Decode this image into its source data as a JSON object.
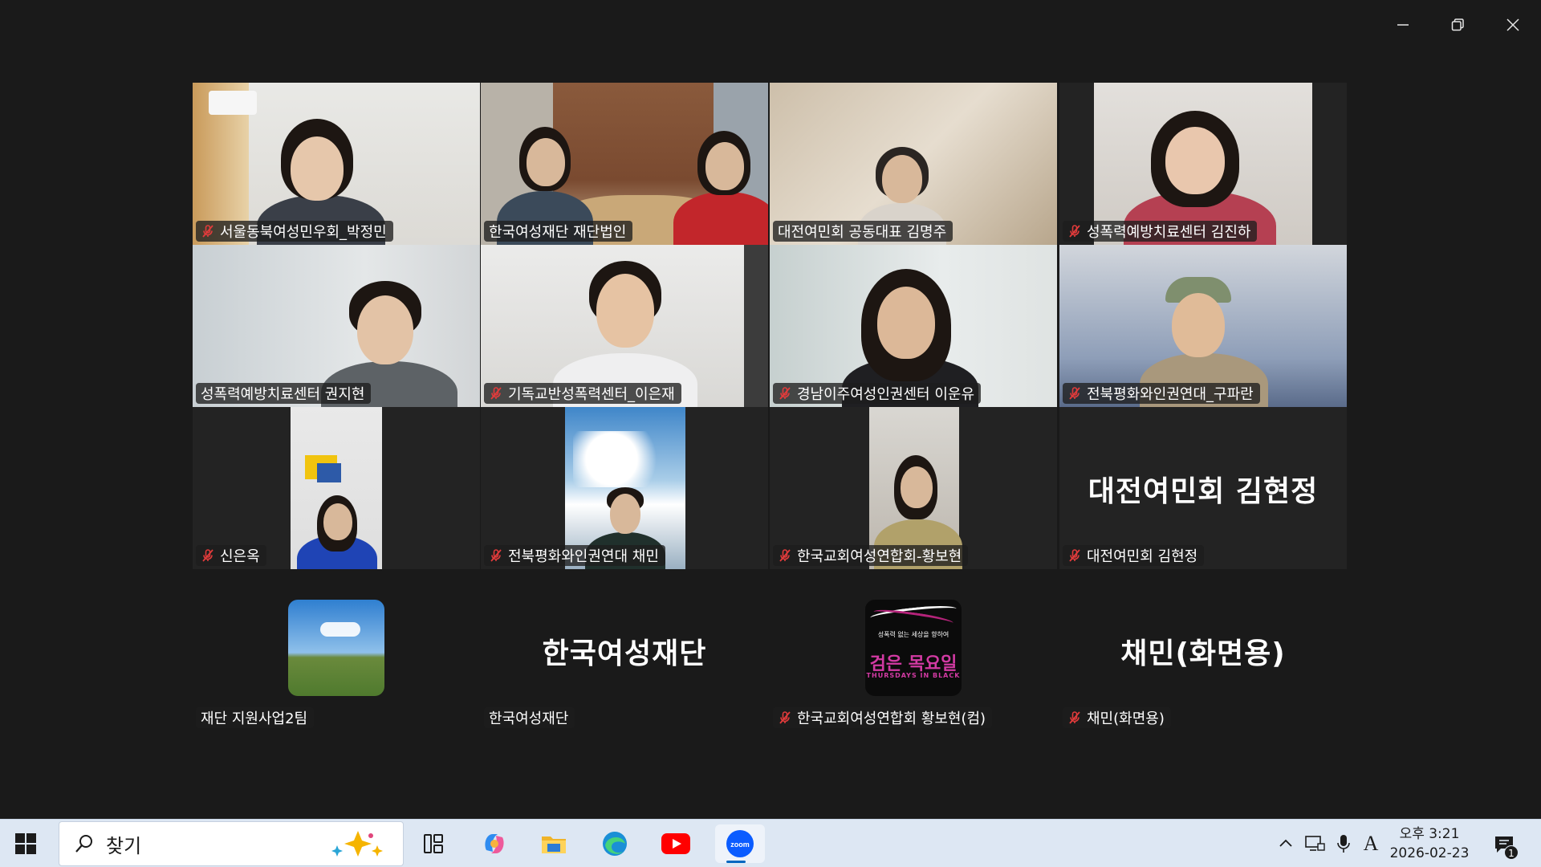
{
  "window": {
    "controls": [
      "minimize",
      "maximize",
      "close"
    ]
  },
  "participants": [
    {
      "name": "서울동북여성민우회_박정민",
      "muted": true,
      "active": false
    },
    {
      "name": "한국여성재단 재단법인",
      "muted": false,
      "active": true
    },
    {
      "name": "대전여민회 공동대표 김명주",
      "muted": false,
      "active": false
    },
    {
      "name": "성폭력예방치료센터 김진하",
      "muted": true,
      "active": false
    },
    {
      "name": "성폭력예방치료센터 권지현",
      "muted": false,
      "active": false
    },
    {
      "name": "기독교반성폭력센터_이은재",
      "muted": true,
      "active": false
    },
    {
      "name": "경남이주여성인권센터 이운유",
      "muted": true,
      "active": false
    },
    {
      "name": "전북평화와인권연대_구파란",
      "muted": true,
      "active": false
    },
    {
      "name": "신은옥",
      "muted": true,
      "active": false
    },
    {
      "name": "전북평화와인권연대 채민",
      "muted": true,
      "active": false
    },
    {
      "name": "한국교회여성연합회-황보현",
      "muted": true,
      "active": false
    },
    {
      "name": "대전여민회 김현정",
      "muted": true,
      "active": false,
      "display_name": "대전여민회 김현정"
    },
    {
      "name": "재단 지원사업2팀",
      "muted": false,
      "active": false
    },
    {
      "name": "한국여성재단",
      "muted": false,
      "active": false,
      "display_name": "한국여성재단"
    },
    {
      "name": "한국교회여성연합회 황보현(컴)",
      "muted": true,
      "active": false,
      "avatar_text_top": "성폭력 없는 세상을 향하여",
      "avatar_text_main": "검은 목요일",
      "avatar_text_sub": "THURSDAYS IN BLACK"
    },
    {
      "name": "채민(화면용)",
      "muted": true,
      "active": false,
      "display_name": "채민(화면용)"
    }
  ],
  "taskbar": {
    "search_placeholder": "찾기",
    "apps": [
      "task-view",
      "copilot",
      "file-explorer",
      "edge",
      "youtube",
      "zoom"
    ],
    "active_app": "zoom",
    "clock": {
      "time": "오후 3:21",
      "date": "2026-02-23"
    },
    "ime_indicator": "A",
    "notification_count": "1"
  },
  "colors": {
    "active_speaker": "#23d959",
    "taskbar": "#dde7f3",
    "mute_red": "#e23b3b"
  }
}
